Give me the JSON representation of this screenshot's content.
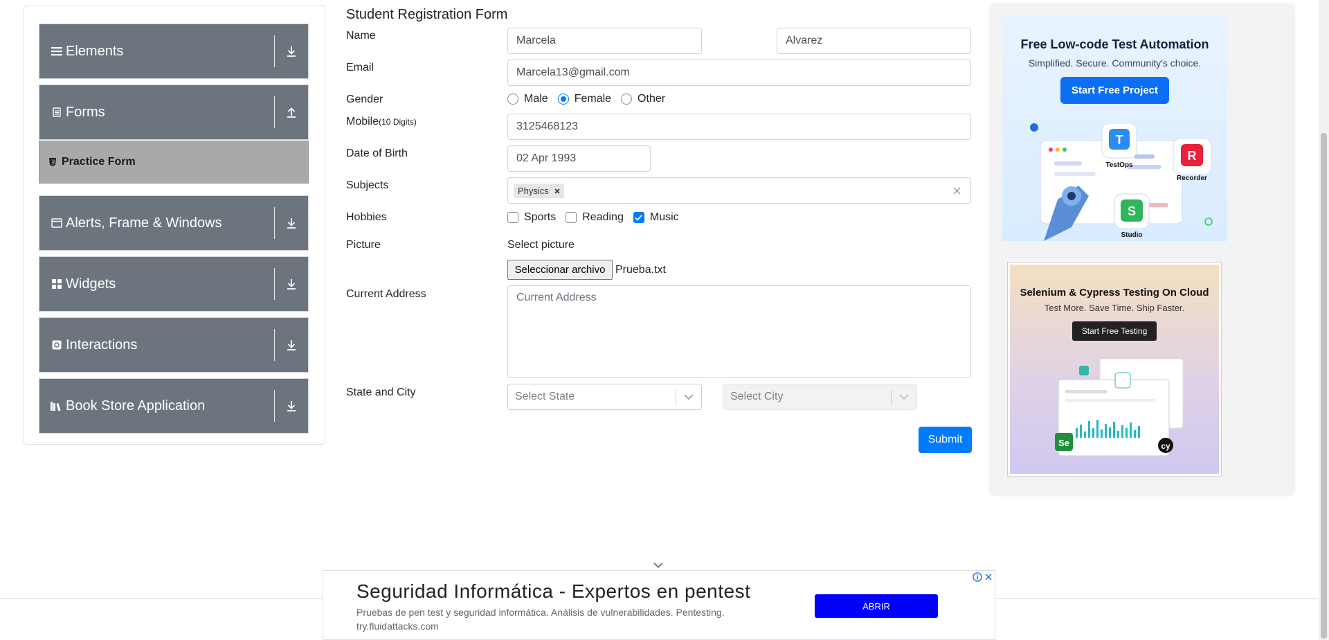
{
  "sidebar": {
    "groups": [
      {
        "label": "Elements",
        "icon": "menu-icon",
        "arrow": "download-icon"
      },
      {
        "label": "Forms",
        "icon": "document-icon",
        "arrow": "upload-icon"
      },
      {
        "label": "Alerts, Frame & Windows",
        "icon": "window-icon",
        "arrow": "download-icon"
      },
      {
        "label": "Widgets",
        "icon": "widgets-icon",
        "arrow": "download-icon"
      },
      {
        "label": "Interactions",
        "icon": "interactions-icon",
        "arrow": "download-icon"
      },
      {
        "label": "Book Store Application",
        "icon": "books-icon",
        "arrow": "download-icon"
      }
    ],
    "active_item": {
      "label": "Practice Form",
      "icon": "html-icon"
    }
  },
  "form": {
    "title": "Student Registration Form",
    "name_label": "Name",
    "first_name": "Marcela",
    "last_name": "Alvarez",
    "email_label": "Email",
    "email": "Marcela13@gmail.com",
    "gender_label": "Gender",
    "gender_options": [
      "Male",
      "Female",
      "Other"
    ],
    "gender_selected": "Female",
    "mobile_label": "Mobile",
    "mobile_hint": "(10 Digits)",
    "mobile": "3125468123",
    "dob_label": "Date of Birth",
    "dob": "02 Apr 1993",
    "subjects_label": "Subjects",
    "subjects": [
      "Physics"
    ],
    "hobbies_label": "Hobbies",
    "hobbies": [
      {
        "label": "Sports",
        "checked": false
      },
      {
        "label": "Reading",
        "checked": false
      },
      {
        "label": "Music",
        "checked": true
      }
    ],
    "picture_label": "Picture",
    "picture_prompt": "Select picture",
    "file_button": "Seleccionar archivo",
    "file_name": "Prueba.txt",
    "address_label": "Current Address",
    "address_placeholder": "Current Address",
    "state_city_label": "State and City",
    "state_placeholder": "Select State",
    "city_placeholder": "Select City",
    "submit_label": "Submit"
  },
  "ads": {
    "ad1": {
      "title": "Free Low-code Test Automation",
      "subtitle": "Simplified. Secure. Community's choice.",
      "cta": "Start Free Project",
      "labels": [
        "TestOps",
        "Recorder",
        "Studio"
      ]
    },
    "ad2": {
      "title": "Selenium & Cypress Testing On Cloud",
      "subtitle": "Test More. Save Time. Ship Faster.",
      "cta": "Start Free Testing"
    }
  },
  "banner": {
    "title": "Seguridad Informática - Expertos en pentest",
    "description": "Pruebas de pen test y seguridad informática. Análisis de vulnerabilidades. Pentesting.",
    "url": "try.fluidattacks.com",
    "cta": "ABRIR"
  },
  "colors": {
    "sidebar_group": "#6c757d",
    "active_item": "#a9a9a9",
    "primary": "#007bff",
    "banner_button": "#0000ff"
  }
}
